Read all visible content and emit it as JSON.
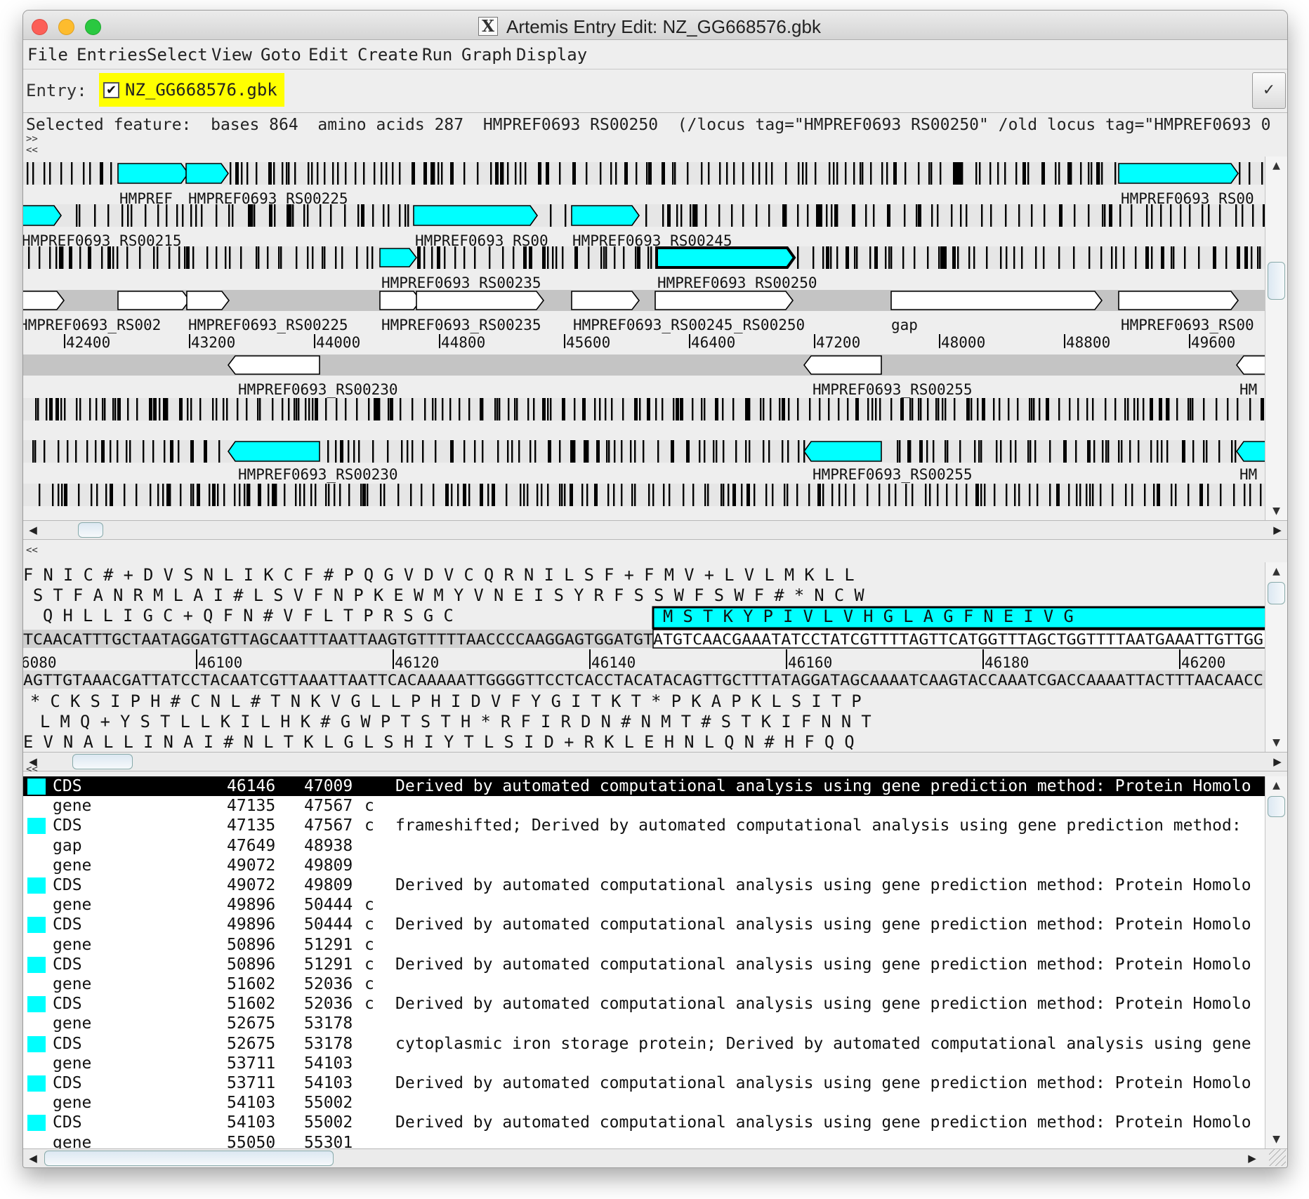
{
  "window": {
    "title": "Artemis Entry Edit: NZ_GG668576.gbk",
    "x_glyph": "X"
  },
  "menus": [
    "File",
    "Entries",
    "Select",
    "View",
    "Goto",
    "Edit",
    "Create",
    "Run",
    "Graph",
    "Display"
  ],
  "entry_bar": {
    "label": "Entry:",
    "entry_name": "NZ_GG668576.gbk",
    "checked": true,
    "check_glyph": "✔",
    "apply_glyph": "✓"
  },
  "selected_feature": "Selected feature:  bases 864  amino acids 287  HMPREF0693 RS00250  (/locus tag=\"HMPREF0693 RS00250\" /old locus tag=\"HMPREF0693 0",
  "nav": {
    "forward": ">>",
    "back": "<<"
  },
  "colors": {
    "feature": "#00ffff",
    "highlight": "#ffff00",
    "track": "#e6e6e6",
    "strand": "#c4c4c4"
  },
  "overview": {
    "ticks": [
      "42400",
      "43200",
      "44000",
      "44800",
      "45600",
      "46400",
      "47200",
      "48000",
      "48800",
      "49600"
    ],
    "labels_f1": [
      "HMPREF",
      "HMPREF0693_RS00225",
      "HMPREF0693_RS00"
    ],
    "labels_f2": [
      "HMPREF0693_RS00215",
      "HMPREF0693_RS00",
      "HMPREF0693_RS00245"
    ],
    "labels_f3": [
      "HMPREF0693_RS00235",
      "HMPREF0693_RS00250"
    ],
    "labels_fwd": [
      "HMPREF0693_RS002",
      "HMPREF0693_RS00225",
      "HMPREF0693_RS00235",
      "HMPREF0693_RS00245",
      "_RS00250",
      "gap",
      "HMPREF0693_RS00"
    ],
    "labels_rev": [
      "HMPREF0693_RS00230",
      "HMPREF0693_RS00255",
      "HM"
    ],
    "labels_r2": [
      "HMPREF0693_RS00230",
      "HMPREF0693_RS00255",
      "HM"
    ]
  },
  "sequence": {
    "frame1": "F N I C # + D V S N L I K C F # P Q G V D V C Q R N I L S F + F M V + L V L M K L L",
    "frame2": "S T F A N R M L A I # L S V F N P K E W M Y V N E I S Y R F S S W F S W F # * N C W",
    "frame3": "Q H L L I G C + Q F N # V F L T P R S G C",
    "frame3_selected": "M S T K Y P I V L V H G L A G F N E I V G",
    "forward_dna": "TCAACATTTGCTAATAGGATGTTAGCAATTTAATTAAGTGTTTTTAACCCCAAGGAGTGGATGTATGTCAACGAAATATCCTATCGTTTTAGTTCATGGTTTAGCTGGTTTTAATGAAATTGTTGG",
    "ruler": [
      "6080",
      "46100",
      "46120",
      "46140",
      "46160",
      "46180",
      "46200"
    ],
    "reverse_dna": "AGTTGTAAACGATTATCCTACAATCGTTAAATTAATTCACAAAAATTGGGGTTCCTCACCTACATACAGTTGCTTTATAGGATAGCAAAATCAAGTACCAAATCGACCAAAATTACTTTAACAACC",
    "rframe1": "* C K S I P H # C N L # T N K V G L L P H I D V F Y G I T K T * P K A P K L S I T P",
    "rframe2": "L M Q + Y S T L L K I L H K # G W P T S T H * R F I R D N # N M T # S T K I F N N T",
    "rframe3": "E V N A L L I N A I # N L T K L G L S H I Y T L S I D + R K L E H N L Q N # H F Q Q"
  },
  "feature_list": [
    {
      "key": "CDS",
      "start": "46146",
      "end": "47009",
      "comp": "",
      "note": "Derived by automated computational analysis using gene prediction method: Protein Homolo",
      "selected": true
    },
    {
      "key": "gene",
      "start": "47135",
      "end": "47567",
      "comp": "c",
      "note": ""
    },
    {
      "key": "CDS",
      "start": "47135",
      "end": "47567",
      "comp": "c",
      "note": "frameshifted; Derived by automated computational analysis using gene prediction method:"
    },
    {
      "key": "gap",
      "start": "47649",
      "end": "48938",
      "comp": "",
      "note": ""
    },
    {
      "key": "gene",
      "start": "49072",
      "end": "49809",
      "comp": "",
      "note": ""
    },
    {
      "key": "CDS",
      "start": "49072",
      "end": "49809",
      "comp": "",
      "note": "Derived by automated computational analysis using gene prediction method: Protein Homolo"
    },
    {
      "key": "gene",
      "start": "49896",
      "end": "50444",
      "comp": "c",
      "note": ""
    },
    {
      "key": "CDS",
      "start": "49896",
      "end": "50444",
      "comp": "c",
      "note": "Derived by automated computational analysis using gene prediction method: Protein Homolo"
    },
    {
      "key": "gene",
      "start": "50896",
      "end": "51291",
      "comp": "c",
      "note": ""
    },
    {
      "key": "CDS",
      "start": "50896",
      "end": "51291",
      "comp": "c",
      "note": "Derived by automated computational analysis using gene prediction method: Protein Homolo"
    },
    {
      "key": "gene",
      "start": "51602",
      "end": "52036",
      "comp": "c",
      "note": ""
    },
    {
      "key": "CDS",
      "start": "51602",
      "end": "52036",
      "comp": "c",
      "note": "Derived by automated computational analysis using gene prediction method: Protein Homolo"
    },
    {
      "key": "gene",
      "start": "52675",
      "end": "53178",
      "comp": "",
      "note": ""
    },
    {
      "key": "CDS",
      "start": "52675",
      "end": "53178",
      "comp": "",
      "note": "cytoplasmic iron storage protein; Derived by automated computational analysis using gene"
    },
    {
      "key": "gene",
      "start": "53711",
      "end": "54103",
      "comp": "",
      "note": ""
    },
    {
      "key": "CDS",
      "start": "53711",
      "end": "54103",
      "comp": "",
      "note": "Derived by automated computational analysis using gene prediction method: Protein Homolo"
    },
    {
      "key": "gene",
      "start": "54103",
      "end": "55002",
      "comp": "",
      "note": ""
    },
    {
      "key": "CDS",
      "start": "54103",
      "end": "55002",
      "comp": "",
      "note": "Derived by automated computational analysis using gene prediction method: Protein Homolo"
    },
    {
      "key": "gene",
      "start": "55050",
      "end": "55301",
      "comp": "",
      "note": ""
    }
  ],
  "scroll_glyphs": {
    "up": "▲",
    "down": "▼",
    "left": "◀",
    "right": "▶",
    "grip": "|||"
  }
}
